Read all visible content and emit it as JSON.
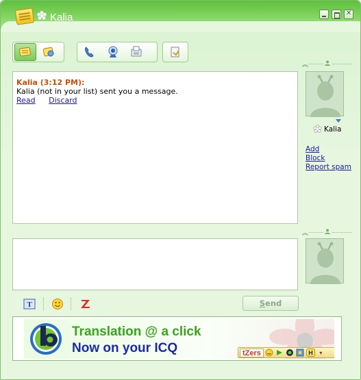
{
  "window": {
    "title": "Kalia"
  },
  "conversation": {
    "sender_header": "Kalia (3:12 PM):",
    "message": "Kalia (not in your list) sent you a message.",
    "read_link": "Read",
    "discard_link": "Discard"
  },
  "contact": {
    "name": "Kalia",
    "add_link": "Add",
    "block_link": "Block",
    "report_link": "Report spam"
  },
  "compose": {
    "value": "",
    "send_label": "Send",
    "send_mnemonic": "S",
    "send_rest": "end"
  },
  "banner": {
    "line1": "Translation @ a click",
    "line2": "Now on your ICQ",
    "tzers_label": "tZers",
    "h_label": "H"
  },
  "colors": {
    "title_bar": "#6ccb48",
    "window_bg": "#e6f6df",
    "sender_header": "#c8500a",
    "link": "#1a1aa6",
    "banner_line1": "#3aa41e",
    "banner_line2": "#1c2aa8"
  }
}
